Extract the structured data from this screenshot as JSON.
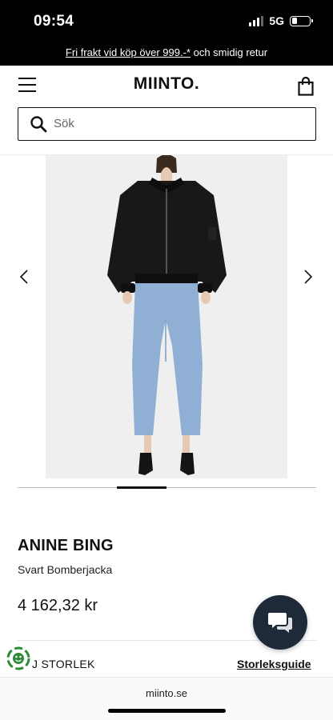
{
  "status_bar": {
    "time": "09:54",
    "network": "5G",
    "battery_level": 0.3
  },
  "promo": {
    "link_text": "Fri frakt vid köp över 999.-*",
    "rest_text": " och smidig retur"
  },
  "header": {
    "logo": "MIINTO.",
    "menu_icon": "hamburger-menu-icon",
    "bag_icon": "shopping-bag-icon"
  },
  "search": {
    "placeholder": "Sök",
    "value": ""
  },
  "gallery": {
    "prev_icon": "chevron-left-icon",
    "next_icon": "chevron-right-icon"
  },
  "product": {
    "brand": "ANINE BING",
    "name": "Svart Bomberjacka",
    "price": "4 162,32 kr"
  },
  "size": {
    "label": "J STORLEK",
    "guide": "Storleksguide"
  },
  "browser": {
    "url": "miinto.se"
  },
  "colors": {
    "background": "#ffffff",
    "promo_bar": "#000000",
    "chat_button": "#1e2a38",
    "image_background": "#efefef",
    "eco_badge": "#2e8b3a"
  }
}
